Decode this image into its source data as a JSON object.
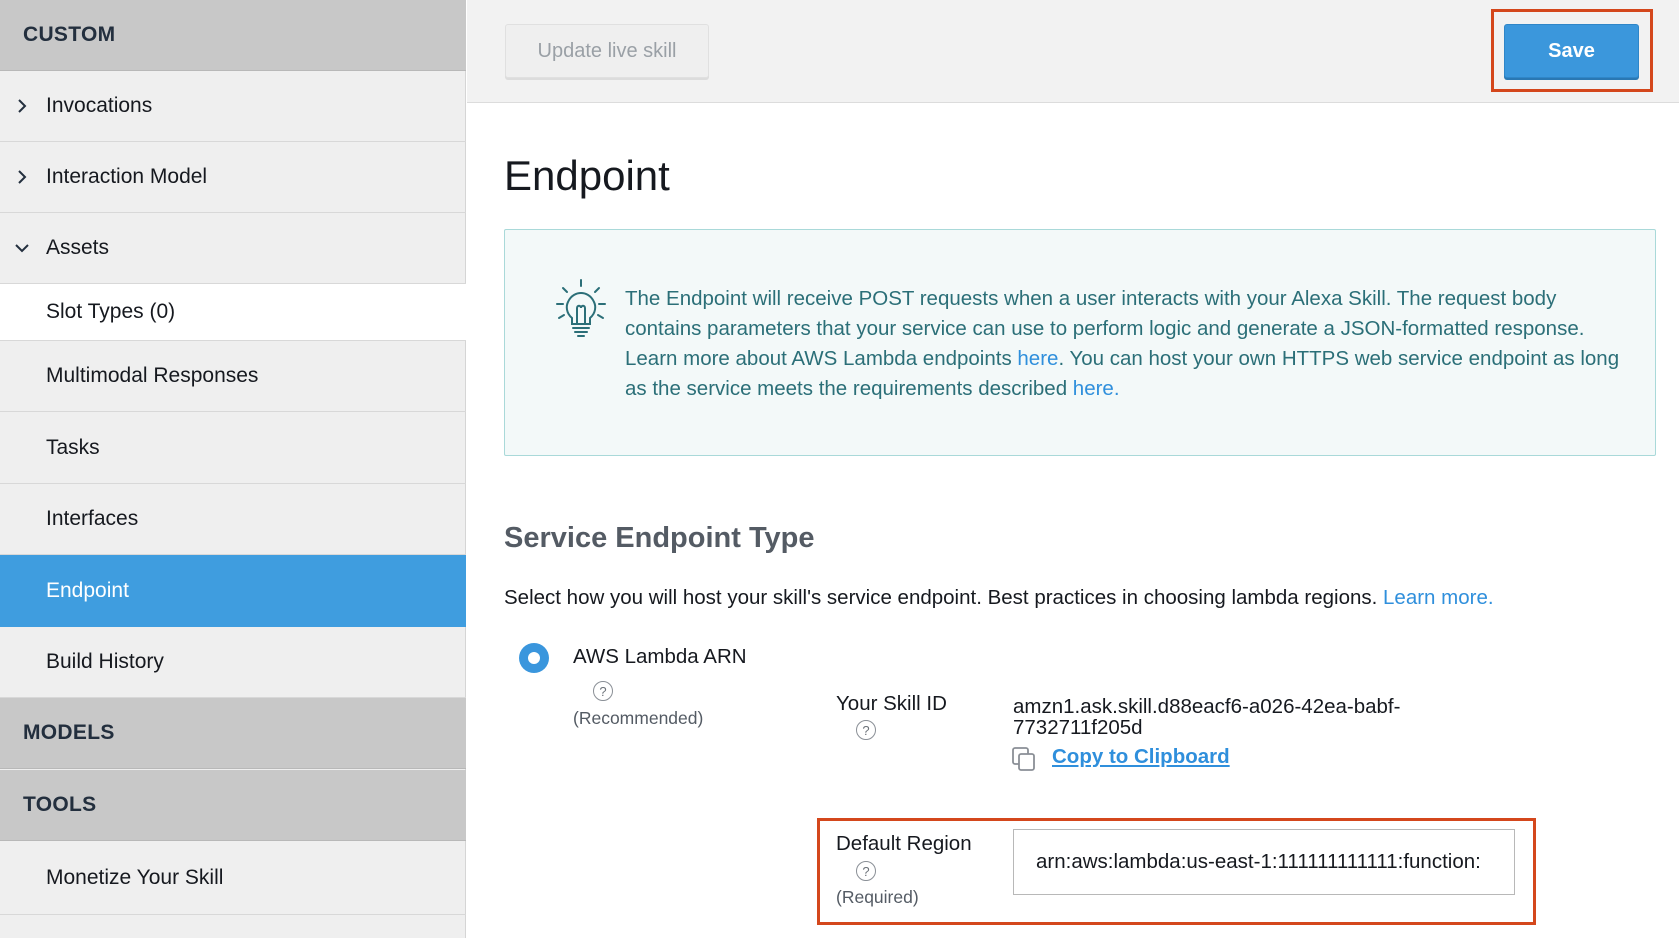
{
  "sidebar": {
    "custom_header": "CUSTOM",
    "items": [
      {
        "label": "Invocations"
      },
      {
        "label": "Interaction Model"
      },
      {
        "label": "Assets"
      },
      {
        "label": "Slot Types (0)"
      },
      {
        "label": "Multimodal Responses"
      },
      {
        "label": "Tasks"
      },
      {
        "label": "Interfaces"
      },
      {
        "label": "Endpoint"
      },
      {
        "label": "Build History"
      }
    ],
    "models_header": "MODELS",
    "tools_header": "TOOLS",
    "tools_items": [
      {
        "label": "Monetize Your Skill"
      }
    ]
  },
  "toolbar": {
    "update_label": "Update live skill",
    "save_label": "Save"
  },
  "main": {
    "title": "Endpoint",
    "info": {
      "text1": "The Endpoint will receive POST requests when a user interacts with your Alexa Skill. The request body contains parameters that your service can use to perform logic and generate a JSON-formatted response. Learn more about AWS Lambda endpoints ",
      "link1": "here",
      "text2": ". You can host your own HTTPS web service endpoint as long as the service meets the requirements described ",
      "link2": "here."
    },
    "service": {
      "title": "Service Endpoint Type",
      "desc": "Select how you will host your skill's service endpoint. Best practices in choosing lambda regions. ",
      "learn_more": "Learn more.",
      "option_label": "AWS Lambda ARN",
      "option_note": "(Recommended)",
      "help_glyph": "?",
      "skill_id_label": "Your Skill ID",
      "skill_id_value": "amzn1.ask.skill.d88eacf6-a026-42ea-babf-7732711f205d",
      "copy_label": "Copy to Clipboard",
      "region_label": "Default Region",
      "region_note": "(Required)",
      "region_value": "arn:aws:lambda:us-east-1:111111111111:function:",
      "region_placeholder": ""
    }
  },
  "colors": {
    "accent": "#3f9ddf",
    "highlight": "#d4471c",
    "link": "#2f8fdc",
    "info_text": "#2b6f78"
  },
  "icons": {
    "collapsed": "chevron-right-icon",
    "expanded": "chevron-down-icon",
    "tip": "lightbulb-icon",
    "help": "question-circle-icon",
    "copy": "copy-icon"
  }
}
